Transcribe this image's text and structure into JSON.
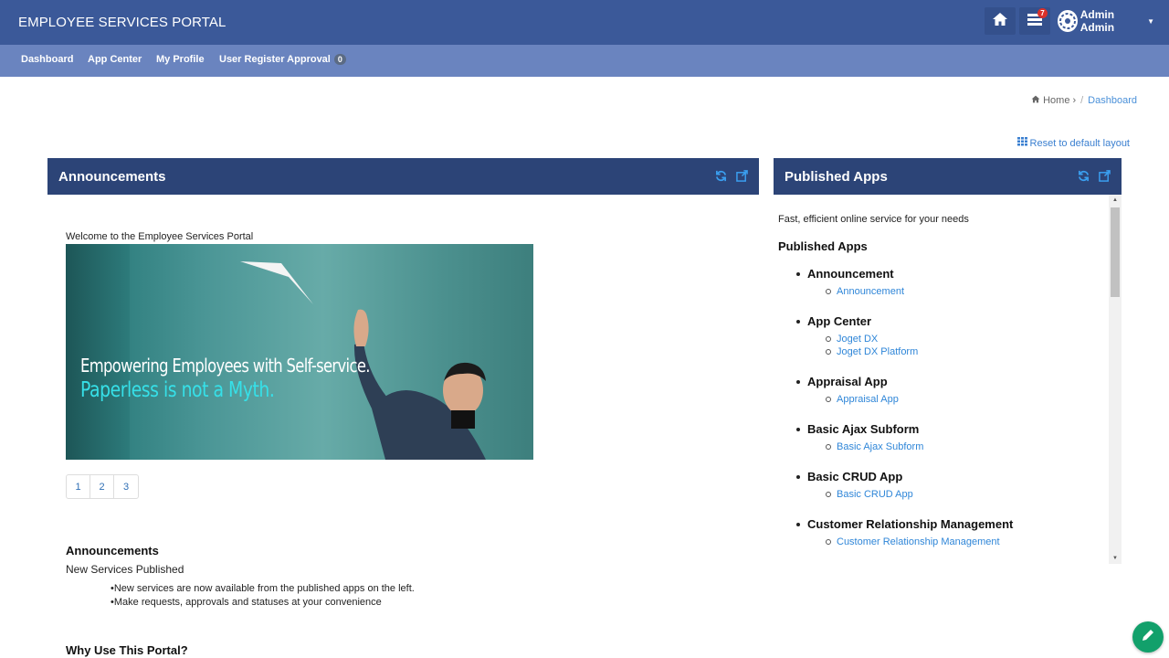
{
  "header": {
    "brand": "EMPLOYEE SERVICES PORTAL",
    "tasks_count": "7",
    "user_name": "Admin Admin"
  },
  "nav": {
    "items": [
      {
        "label": "Dashboard"
      },
      {
        "label": "App Center"
      },
      {
        "label": "My Profile"
      },
      {
        "label": "User Register Approval"
      }
    ],
    "approval_count": "0"
  },
  "breadcrumb": {
    "home": "Home",
    "current": "Dashboard"
  },
  "reset_layout_label": "Reset to default layout",
  "announcements": {
    "title": "Announcements",
    "welcome": "Welcome to the Employee Services Portal",
    "banner_line1": "Empowering Employees with Self-service.",
    "banner_line2": "Paperless is not a Myth.",
    "pages": [
      "1",
      "2",
      "3"
    ],
    "heading": "Announcements",
    "subheading": "New Services Published",
    "bullets": [
      "New services are now available from the published apps on the left.",
      "Make requests, approvals and statuses at your convenience"
    ],
    "why_heading": "Why Use This Portal?"
  },
  "published_apps": {
    "title": "Published Apps",
    "tagline": "Fast, efficient online service for your needs",
    "heading": "Published Apps",
    "apps": [
      {
        "name": "Announcement",
        "links": [
          "Announcement"
        ]
      },
      {
        "name": "App Center",
        "links": [
          "Joget DX",
          "Joget DX Platform"
        ]
      },
      {
        "name": "Appraisal App",
        "links": [
          "Appraisal App"
        ]
      },
      {
        "name": "Basic Ajax Subform",
        "links": [
          "Basic Ajax Subform"
        ]
      },
      {
        "name": "Basic CRUD App",
        "links": [
          "Basic CRUD App"
        ]
      },
      {
        "name": "Customer Relationship Management",
        "links": [
          "Customer Relationship Management"
        ]
      }
    ]
  },
  "colors": {
    "header_bg": "#3b5999",
    "nav_bg": "#6a84bf",
    "panel_head_bg": "#2c4477",
    "link": "#2f86d8",
    "fab": "#12a06b"
  }
}
